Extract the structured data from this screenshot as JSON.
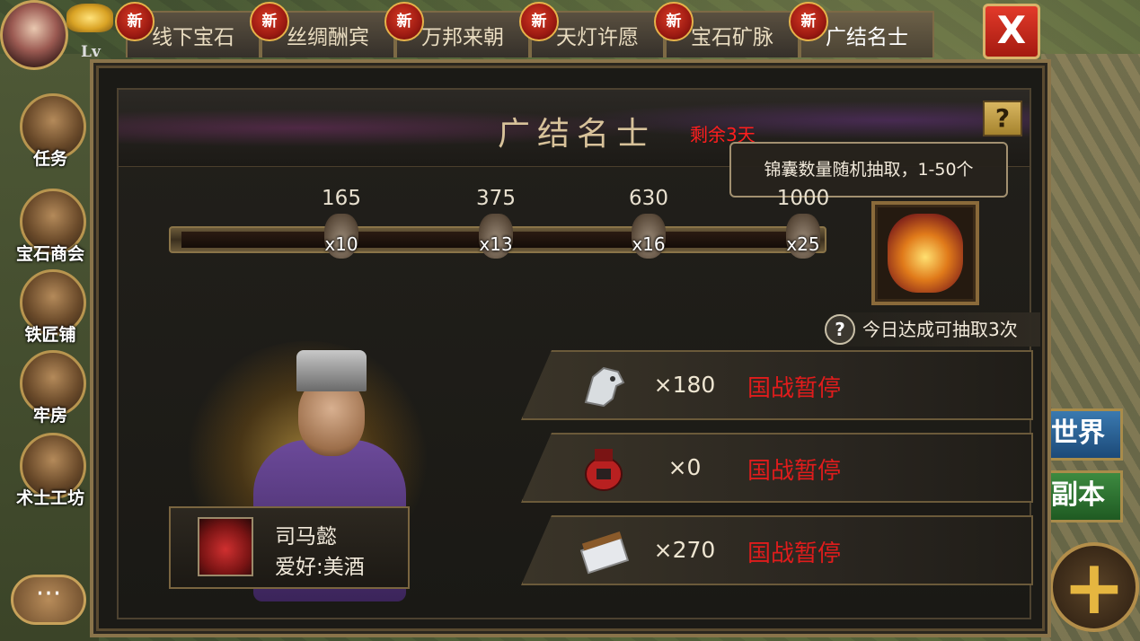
{
  "player": {
    "level_label": "Lv"
  },
  "tabs": [
    {
      "label": "线下宝石",
      "badge": "新"
    },
    {
      "label": "丝绸酬宾",
      "badge": "新"
    },
    {
      "label": "万邦来朝",
      "badge": "新"
    },
    {
      "label": "天灯许愿",
      "badge": "新"
    },
    {
      "label": "宝石矿脉",
      "badge": "新"
    },
    {
      "label": "广结名士",
      "badge": "新",
      "active": true
    }
  ],
  "close_label": "X",
  "sidebar": {
    "items": [
      {
        "label": "任务"
      },
      {
        "label": "宝石商会"
      },
      {
        "label": "铁匠铺"
      },
      {
        "label": "牢房"
      },
      {
        "label": "术士工坊"
      }
    ],
    "chat_label": "···"
  },
  "right_buttons": {
    "world": "世界",
    "dungeon": "副本",
    "plus": "+"
  },
  "event": {
    "title": "广结名士",
    "remaining": "剩余3天",
    "help": "?",
    "tooltip": "锦囊数量随机抽取，1-50个",
    "progress": {
      "current": 0,
      "max": 1000
    },
    "milestones": [
      {
        "value": "165",
        "count": "x10"
      },
      {
        "value": "375",
        "count": "x13"
      },
      {
        "value": "630",
        "count": "x16"
      },
      {
        "value": "1000",
        "count": "x25"
      }
    ],
    "daily_note": "今日达成可抽取3次",
    "daily_help": "?",
    "resources": [
      {
        "icon": "horse-icon",
        "amount": "×180",
        "status": "国战暂停"
      },
      {
        "icon": "wine-jar-icon",
        "amount": "×0",
        "status": "国战暂停"
      },
      {
        "icon": "scroll-icon",
        "amount": "×270",
        "status": "国战暂停"
      }
    ],
    "hero": {
      "name": "司马懿",
      "hobby": "爱好:美酒"
    }
  },
  "colors": {
    "accent_red": "#e01c1c",
    "gold_border": "#8a744a",
    "title_text": "#d8c29a"
  }
}
